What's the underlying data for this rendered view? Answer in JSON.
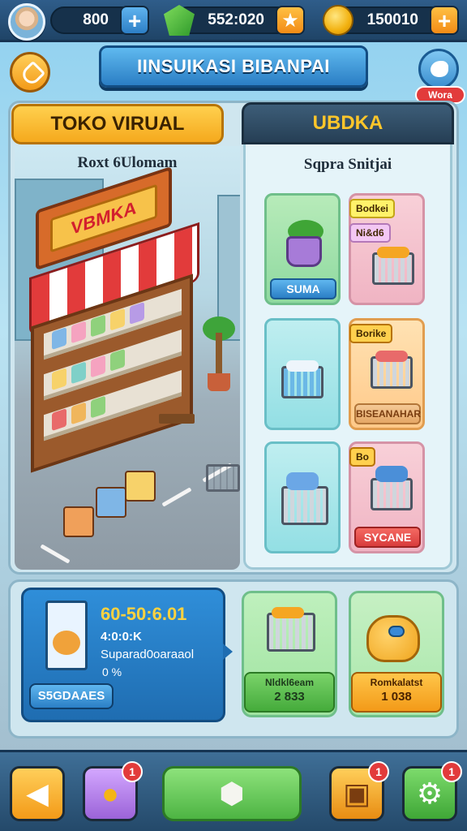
{
  "top": {
    "res1": {
      "value": "800"
    },
    "res2": {
      "value": "552:020"
    },
    "res3": {
      "value": "150010"
    }
  },
  "title": {
    "banner": "IINSUIKASI BIBANPAI",
    "notice_tag": "Wora"
  },
  "tabs": {
    "left": "TOKO VIRUAL",
    "right": "UBDKA"
  },
  "scene": {
    "caption": "Roxt 6Ulomam",
    "shop_sign": "VBMKA"
  },
  "store": {
    "caption": "Sqpra Snitjai",
    "cards": [
      {
        "button": "SUMA"
      },
      {
        "tag1": "Bodkei",
        "tag2": "Ni&d6"
      },
      {},
      {
        "tag": "Borike",
        "button": "BISEANAHAR"
      },
      {},
      {
        "tag": "Bo",
        "button": "SYCANE"
      }
    ]
  },
  "promo": {
    "title": "60-50:6.01",
    "subtitle": "4:0:0:K",
    "desc": "Suparad0oaraaol",
    "dots": "0 %",
    "button": "S5GDAAES"
  },
  "offers": [
    {
      "line1": "Nldkl6eam",
      "line2": "2 833"
    },
    {
      "line1": "Romkalatst",
      "line2": "1 038"
    }
  ],
  "nav": {
    "badges": [
      "1",
      "1",
      "1"
    ]
  },
  "colors": {
    "accent_blue": "#2b7ec4",
    "accent_orange": "#f39a18",
    "accent_green": "#45ab3b",
    "badge_red": "#e23b3b"
  },
  "icons": {
    "res1": "plus-icon",
    "res2": "star-icon",
    "res3": "plus-icon",
    "nav": [
      "back-arrow-icon",
      "coin-stack-icon",
      "cube-icon",
      "box-face-icon",
      "gear-icon"
    ]
  }
}
